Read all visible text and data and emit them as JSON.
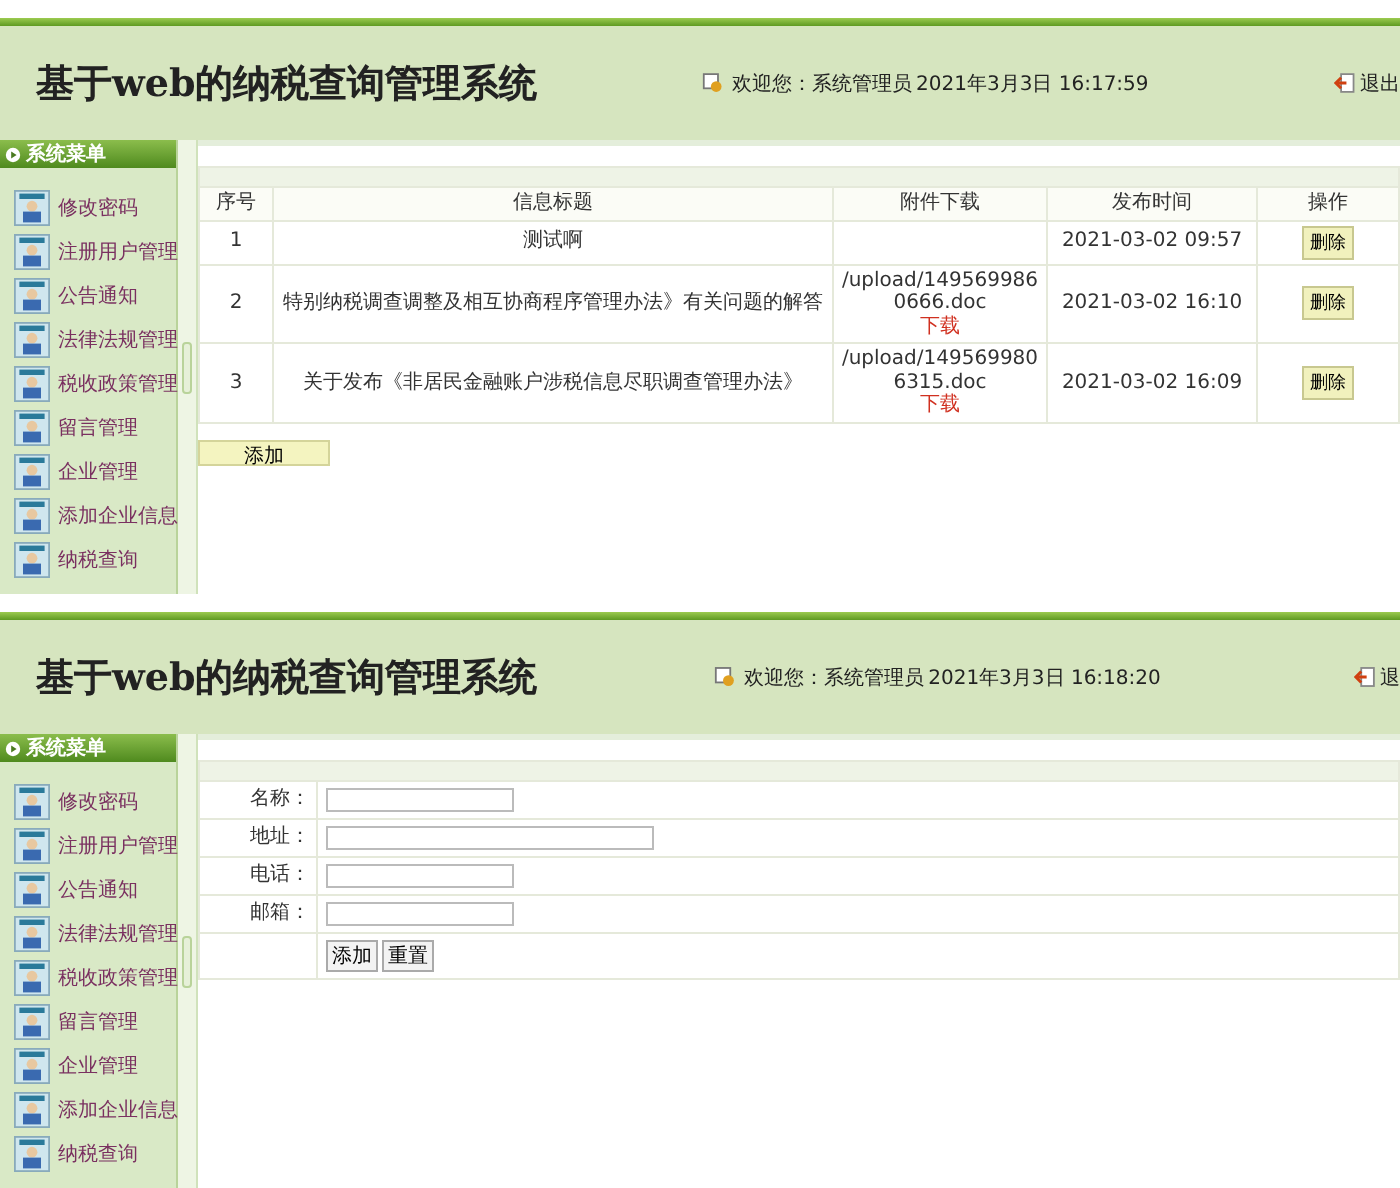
{
  "screens": [
    {
      "header": {
        "title": "基于web的纳税查询管理系统",
        "welcome": "欢迎您：系统管理员",
        "datetime": "2021年3月3日  16:17:59",
        "logout": "退出"
      },
      "sidebar": {
        "title": "系统菜单",
        "items": [
          "修改密码",
          "注册用户管理",
          "公告通知",
          "法律法规管理",
          "税收政策管理",
          "留言管理",
          "企业管理",
          "添加企业信息",
          "纳税查询"
        ]
      },
      "content": {
        "kind": "list",
        "columns": [
          "序号",
          "信息标题",
          "附件下载",
          "发布时间",
          "操作"
        ],
        "rows": [
          {
            "no": "1",
            "title": "测试啊",
            "time": "2021-03-02 09:57",
            "action": "删除"
          },
          {
            "no": "2",
            "title": "特别纳税调查调整及相互协商程序管理办法》有关问题的解答",
            "attachment": {
              "path": "/upload/1495699860666.doc",
              "link": "下载"
            },
            "time": "2021-03-02 16:10",
            "action": "删除"
          },
          {
            "no": "3",
            "title": "关于发布《非居民金融账户涉税信息尽职调查管理办法》",
            "attachment": {
              "path": "/upload/1495699806315.doc",
              "link": "下载"
            },
            "time": "2021-03-02 16:09",
            "action": "删除"
          }
        ],
        "add_button": "添加"
      }
    },
    {
      "header": {
        "title": "基于web的纳税查询管理系统",
        "welcome": "欢迎您：系统管理员",
        "datetime": "2021年3月3日  16:18:20",
        "logout": "退"
      },
      "sidebar": {
        "title": "系统菜单",
        "items": [
          "修改密码",
          "注册用户管理",
          "公告通知",
          "法律法规管理",
          "税收政策管理",
          "留言管理",
          "企业管理",
          "添加企业信息",
          "纳税查询"
        ]
      },
      "content": {
        "kind": "form",
        "fields": [
          {
            "label": "名称：",
            "wide": false
          },
          {
            "label": "地址：",
            "wide": true
          },
          {
            "label": "电话：",
            "wide": false
          },
          {
            "label": "邮箱：",
            "wide": false
          }
        ],
        "buttons": [
          "添加",
          "重置"
        ]
      }
    }
  ]
}
